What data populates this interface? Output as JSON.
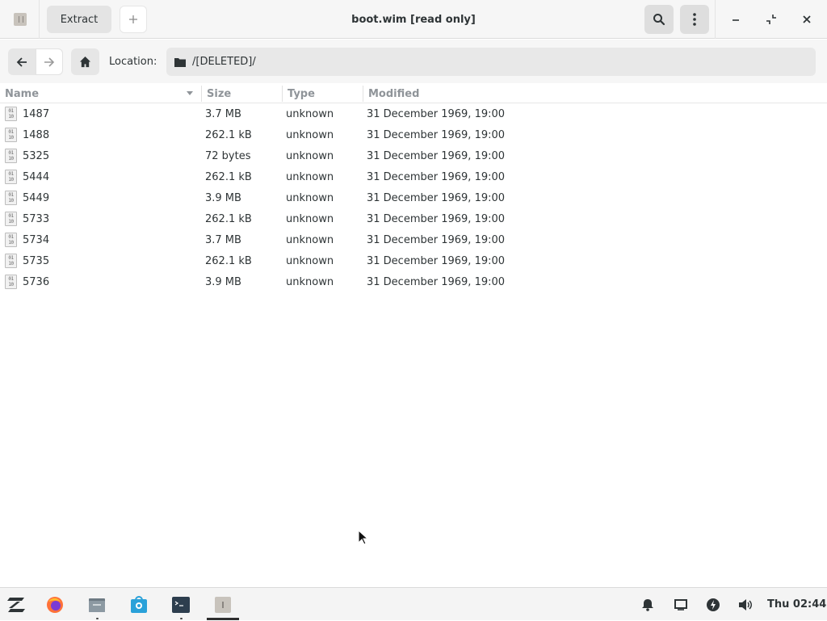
{
  "window": {
    "title": "boot.wim [read only]",
    "extract_label": "Extract",
    "add_label": "+"
  },
  "location": {
    "label": "Location:",
    "path": "/[DELETED]/"
  },
  "columns": {
    "name": "Name",
    "size": "Size",
    "type": "Type",
    "modified": "Modified"
  },
  "files": [
    {
      "name": "1487",
      "size": "3.7 MB",
      "type": "unknown",
      "modified": "31 December 1969, 19:00"
    },
    {
      "name": "1488",
      "size": "262.1 kB",
      "type": "unknown",
      "modified": "31 December 1969, 19:00"
    },
    {
      "name": "5325",
      "size": "72 bytes",
      "type": "unknown",
      "modified": "31 December 1969, 19:00"
    },
    {
      "name": "5444",
      "size": "262.1 kB",
      "type": "unknown",
      "modified": "31 December 1969, 19:00"
    },
    {
      "name": "5449",
      "size": "3.9 MB",
      "type": "unknown",
      "modified": "31 December 1969, 19:00"
    },
    {
      "name": "5733",
      "size": "262.1 kB",
      "type": "unknown",
      "modified": "31 December 1969, 19:00"
    },
    {
      "name": "5734",
      "size": "3.7 MB",
      "type": "unknown",
      "modified": "31 December 1969, 19:00"
    },
    {
      "name": "5735",
      "size": "262.1 kB",
      "type": "unknown",
      "modified": "31 December 1969, 19:00"
    },
    {
      "name": "5736",
      "size": "3.9 MB",
      "type": "unknown",
      "modified": "31 December 1969, 19:00"
    }
  ],
  "file_icon_glyph": [
    "01",
    "10"
  ],
  "taskbar": {
    "apps": [
      "zorin-menu-icon",
      "firefox-icon",
      "files-icon",
      "software-store-icon",
      "terminal-icon",
      "archive-manager-icon"
    ],
    "tray": [
      "bell-icon",
      "display-icon",
      "power-icon",
      "volume-icon"
    ],
    "clock": "Thu 02:44"
  },
  "colors": {
    "accent_firefox": "#ff7139",
    "store_blue": "#2aa1d9",
    "terminal_dark": "#2d3e4e"
  }
}
